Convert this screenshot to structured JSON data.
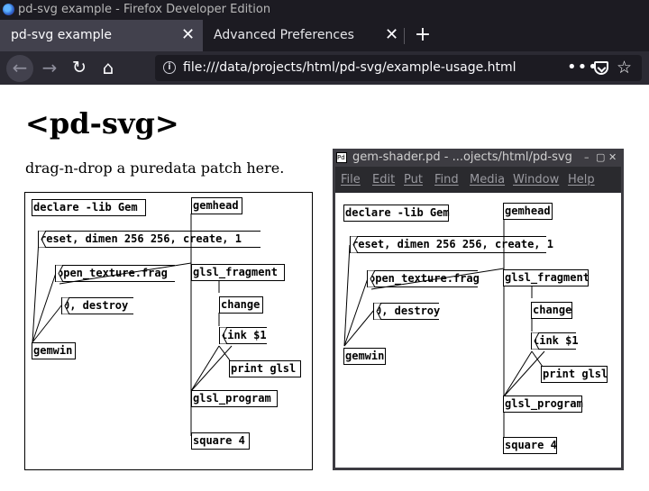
{
  "window": {
    "title": "pd-svg example - Firefox Developer Edition"
  },
  "tabs": [
    {
      "label": "pd-svg example",
      "active": true
    },
    {
      "label": "Advanced Preferences",
      "active": false
    }
  ],
  "toolbar": {
    "url": "file:///data/projects/html/pd-svg/example-usage.html",
    "back_icon": "←",
    "forward_icon": "→",
    "reload_icon": "↻",
    "home_icon": "⌂",
    "more_icon": "•••",
    "star_icon": "☆",
    "close_icon": "✕",
    "new_tab_icon": "+"
  },
  "page": {
    "heading": "<pd-svg>",
    "hint": "drag-n-drop a puredata patch here."
  },
  "patch": {
    "objects": [
      {
        "id": "declare",
        "text": "declare -lib Gem",
        "kind": "obj"
      },
      {
        "id": "reset",
        "text": "reset, dimen 256 256, create, 1",
        "kind": "msg"
      },
      {
        "id": "open",
        "text": "open_texture.frag",
        "kind": "msg"
      },
      {
        "id": "destroy",
        "text": "0, destroy",
        "kind": "msg"
      },
      {
        "id": "gemwin",
        "text": "gemwin",
        "kind": "obj"
      },
      {
        "id": "gemhead",
        "text": "gemhead",
        "kind": "obj"
      },
      {
        "id": "glsl_fragment",
        "text": "glsl_fragment",
        "kind": "obj"
      },
      {
        "id": "change",
        "text": "change",
        "kind": "obj"
      },
      {
        "id": "link",
        "text": "link $1",
        "kind": "msg"
      },
      {
        "id": "print",
        "text": "print glsl",
        "kind": "obj"
      },
      {
        "id": "glsl_program",
        "text": "glsl_program",
        "kind": "obj"
      },
      {
        "id": "square",
        "text": "square 4",
        "kind": "obj"
      }
    ]
  },
  "pd_window": {
    "title": "gem-shader.pd  - ...ojects/html/pd-svg",
    "icon_text": "Pd",
    "buttons": [
      "–",
      "▢",
      "✕"
    ],
    "menu": [
      "File",
      "Edit",
      "Put",
      "Find",
      "Media",
      "Window",
      "Help"
    ]
  }
}
